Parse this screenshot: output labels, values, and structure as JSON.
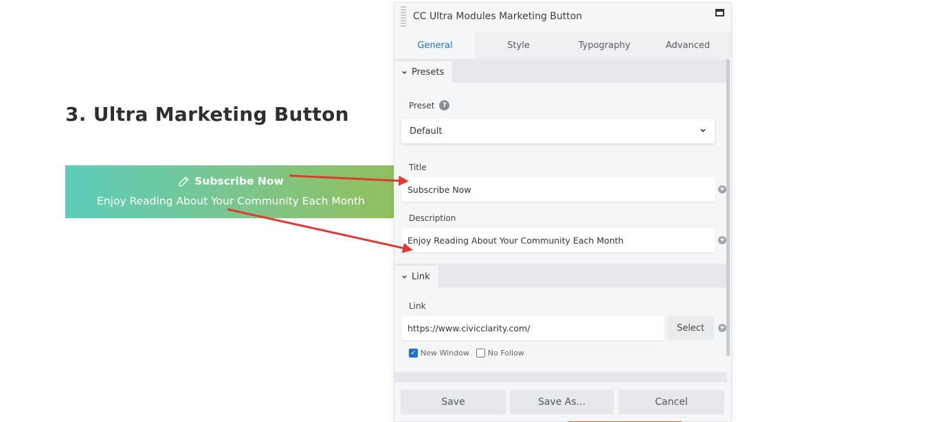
{
  "page": {
    "heading": "3. Ultra Marketing Button"
  },
  "marketing_button": {
    "title": "Subscribe Now",
    "description": "Enjoy Reading About Your Community Each Month",
    "icon": "pencil-icon"
  },
  "panel": {
    "title": "CC Ultra Modules Marketing Button",
    "tabs": [
      {
        "label": "General"
      },
      {
        "label": "Style"
      },
      {
        "label": "Typography"
      },
      {
        "label": "Advanced"
      }
    ],
    "presets_section": {
      "label": "Presets",
      "preset_label": "Preset",
      "preset_value": "Default"
    },
    "title_field": {
      "label": "Title",
      "value": "Subscribe Now"
    },
    "description_field": {
      "label": "Description",
      "value": "Enjoy Reading About Your Community Each Month"
    },
    "link_section": {
      "label": "Link",
      "link_label": "Link",
      "link_value": "https://www.civicclarity.com/",
      "select_label": "Select",
      "new_window_label": "New Window",
      "no_follow_label": "No Follow"
    },
    "footer": {
      "save_label": "Save",
      "save_as_label": "Save As...",
      "cancel_label": "Cancel"
    }
  },
  "colors": {
    "accent": "#1e73be",
    "button_gradient_start": "#5ccdba",
    "button_gradient_end": "#93c05c",
    "arrow": "#e03a30"
  }
}
